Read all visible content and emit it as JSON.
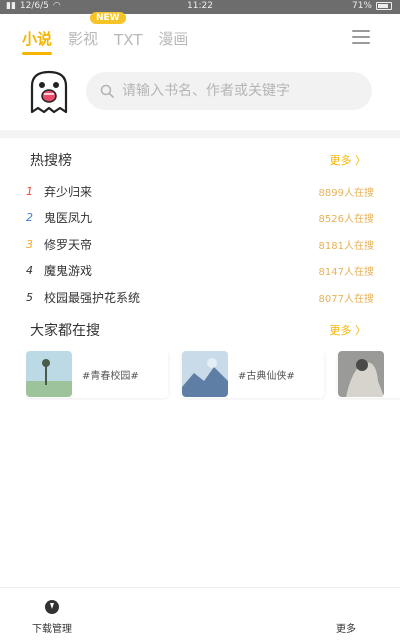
{
  "status_bar": {
    "left_text": "12/6/5",
    "time": "11:22",
    "battery": "71%"
  },
  "tabs": [
    {
      "label": "小说",
      "active": true
    },
    {
      "label": "影视",
      "active": false
    },
    {
      "label": "TXT",
      "active": false
    },
    {
      "label": "漫画",
      "active": false
    }
  ],
  "new_badge": "NEW",
  "search": {
    "placeholder": "请输入书名、作者或关键字"
  },
  "hot": {
    "title": "热搜榜",
    "more": "更多 〉",
    "items": [
      {
        "rank": "1",
        "title": "弃少归来",
        "count": "8899人在搜",
        "color": "#e74c3c"
      },
      {
        "rank": "2",
        "title": "鬼医凤九",
        "count": "8526人在搜",
        "color": "#3d7fd6"
      },
      {
        "rank": "3",
        "title": "修罗天帝",
        "count": "8181人在搜",
        "color": "#f5a623"
      },
      {
        "rank": "4",
        "title": "魔鬼游戏",
        "count": "8147人在搜",
        "color": "#333333"
      },
      {
        "rank": "5",
        "title": "校园最强护花系统",
        "count": "8077人在搜",
        "color": "#333333"
      }
    ]
  },
  "popular": {
    "title": "大家都在搜",
    "more": "更多 〉",
    "cards": [
      {
        "label": "#青春校园#",
        "thumb_color": "#9fc7d8"
      },
      {
        "label": "#古典仙侠#",
        "thumb_color": "#6a8fb8"
      },
      {
        "label": "",
        "thumb_color": "#8a8a88"
      }
    ]
  },
  "bottom_nav": {
    "download_label": "下载管理",
    "other_label": "更多"
  },
  "colors": {
    "accent": "#f5b500",
    "count_color": "#e7b25b"
  }
}
